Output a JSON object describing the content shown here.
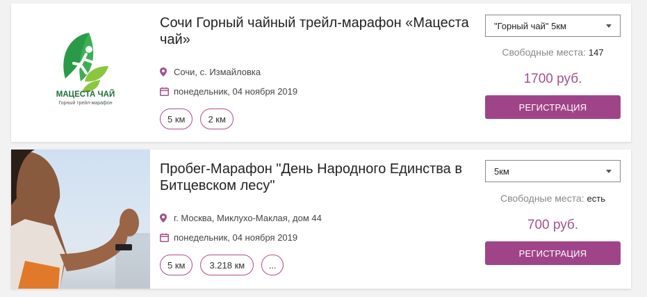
{
  "events": [
    {
      "title": "Сочи Горный чайный трейл-марафон «Мацеста чай»",
      "logo": {
        "name": "МАЦЕСТА ЧАЙ",
        "tagline": "Горный трейл-марафон"
      },
      "location": "Сочи, с. Измайловка",
      "date": "понедельник, 04 ноября 2019",
      "distances": [
        "5 км",
        "2 км"
      ],
      "selected_distance": "\"Горный чай\" 5км",
      "seats_label": "Свободные места:",
      "seats_value": "147",
      "price": "1700 руб.",
      "register_label": "РЕГИСТРАЦИЯ"
    },
    {
      "title": "Пробег-Марафон \"День Народного Единства в Битцевском лесу\"",
      "location": "г. Москва, Миклухо-Маклая, дом 44",
      "date": "понедельник, 04 ноября 2019",
      "distances": [
        "5 км",
        "3.218 км",
        "..."
      ],
      "selected_distance": "5км",
      "seats_label": "Свободные места:",
      "seats_value": "есть",
      "price": "700 руб.",
      "register_label": "РЕГИСТРАЦИЯ"
    }
  ],
  "icons": {
    "location": "map-pin-icon",
    "date": "calendar-icon",
    "dropdown": "caret-down-icon"
  },
  "colors": {
    "accent": "#a04489",
    "price": "#a3508e",
    "logo_green": "#2a9a48"
  }
}
